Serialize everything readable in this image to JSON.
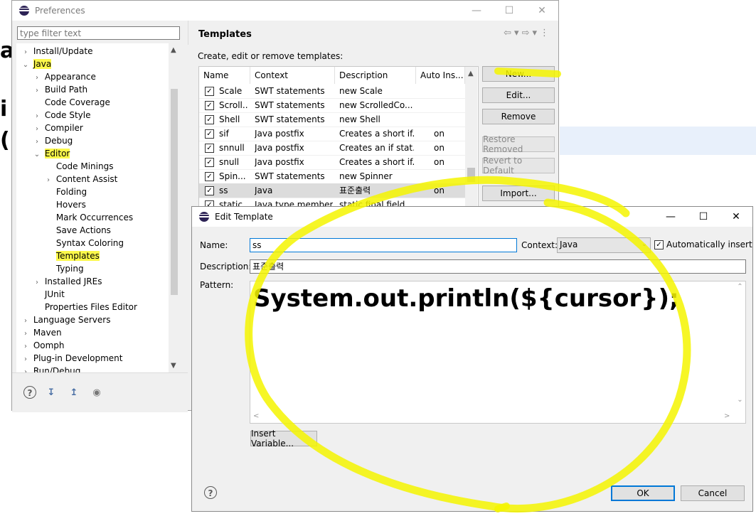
{
  "background": {
    "fragments": [
      "a",
      "i",
      "("
    ]
  },
  "preferences": {
    "title": "Preferences",
    "filter_placeholder": "type filter text",
    "tree": [
      {
        "label": "Install/Update",
        "twisty": "collapsed"
      },
      {
        "label": "Java",
        "twisty": "expanded",
        "highlight": true
      },
      {
        "label": "Appearance",
        "twisty": "collapsed"
      },
      {
        "label": "Build Path",
        "twisty": "collapsed"
      },
      {
        "label": "Code Coverage",
        "twisty": "none"
      },
      {
        "label": "Code Style",
        "twisty": "collapsed"
      },
      {
        "label": "Compiler",
        "twisty": "collapsed"
      },
      {
        "label": "Debug",
        "twisty": "collapsed"
      },
      {
        "label": "Editor",
        "twisty": "expanded",
        "highlight": true
      },
      {
        "label": "Code Minings",
        "twisty": "none"
      },
      {
        "label": "Content Assist",
        "twisty": "collapsed"
      },
      {
        "label": "Folding",
        "twisty": "none"
      },
      {
        "label": "Hovers",
        "twisty": "none"
      },
      {
        "label": "Mark Occurrences",
        "twisty": "none"
      },
      {
        "label": "Save Actions",
        "twisty": "none"
      },
      {
        "label": "Syntax Coloring",
        "twisty": "none"
      },
      {
        "label": "Templates",
        "twisty": "none",
        "highlight": true
      },
      {
        "label": "Typing",
        "twisty": "none"
      },
      {
        "label": "Installed JREs",
        "twisty": "collapsed"
      },
      {
        "label": "JUnit",
        "twisty": "none"
      },
      {
        "label": "Properties Files Editor",
        "twisty": "none"
      },
      {
        "label": "Language Servers",
        "twisty": "collapsed"
      },
      {
        "label": "Maven",
        "twisty": "collapsed"
      },
      {
        "label": "Oomph",
        "twisty": "collapsed"
      },
      {
        "label": "Plug-in Development",
        "twisty": "collapsed"
      },
      {
        "label": "Run/Debug",
        "twisty": "collapsed"
      }
    ],
    "page_title": "Templates",
    "page_description": "Create, edit or remove templates:",
    "columns": [
      "Name",
      "Context",
      "Description",
      "Auto Ins..."
    ],
    "rows": [
      {
        "name": "Scale",
        "context": "SWT statements",
        "description": "new Scale",
        "auto": ""
      },
      {
        "name": "Scroll...",
        "context": "SWT statements",
        "description": "new ScrolledCo...",
        "auto": ""
      },
      {
        "name": "Shell",
        "context": "SWT statements",
        "description": "new Shell",
        "auto": ""
      },
      {
        "name": "sif",
        "context": "Java postfix",
        "description": "Creates a short if...",
        "auto": "on"
      },
      {
        "name": "snnull",
        "context": "Java postfix",
        "description": "Creates an if stat...",
        "auto": "on"
      },
      {
        "name": "snull",
        "context": "Java postfix",
        "description": "Creates a short if...",
        "auto": "on"
      },
      {
        "name": "Spin...",
        "context": "SWT statements",
        "description": "new Spinner",
        "auto": ""
      },
      {
        "name": "ss",
        "context": "Java",
        "description": "표준출력",
        "auto": "on",
        "selected": true
      },
      {
        "name": "static",
        "context": "Java type members",
        "description": "static final field",
        "auto": ""
      }
    ],
    "buttons": {
      "new": "New...",
      "edit": "Edit...",
      "remove": "Remove",
      "restore_removed": "Restore Removed",
      "revert_to_default": "Revert to Default",
      "import": "Import..."
    }
  },
  "edit_template": {
    "title": "Edit Template",
    "name_label": "Name:",
    "name_value": "ss",
    "context_label": "Context:",
    "context_value": "Java",
    "auto_insert_label": "Automatically insert",
    "auto_insert_checked": true,
    "description_label": "Description:",
    "description_value": "표준출력",
    "pattern_label": "Pattern:",
    "pattern_value": "System.out.println(${cursor});",
    "insert_variable": "Insert Variable...",
    "ok": "OK",
    "cancel": "Cancel"
  },
  "colors": {
    "highlight": "#fbf84a",
    "annotation": "#f5f500"
  }
}
